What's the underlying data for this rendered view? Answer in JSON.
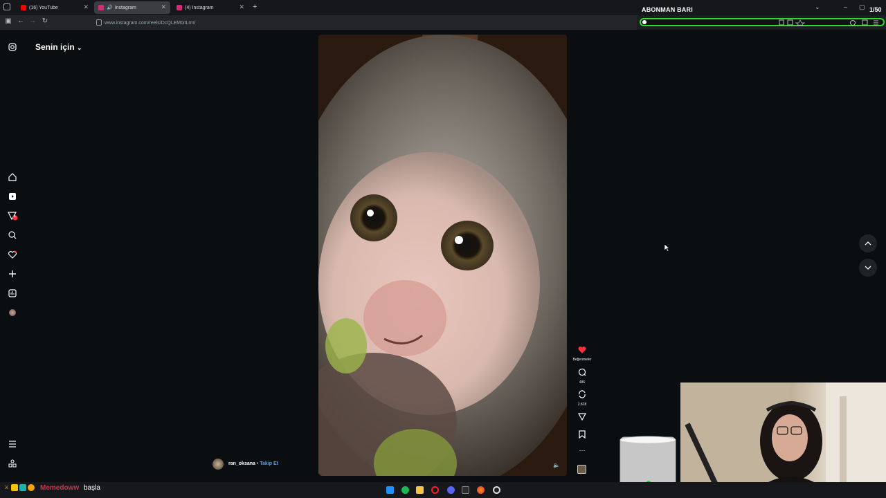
{
  "browser": {
    "tabs": [
      {
        "label": "(16) YouTube",
        "color": "#ff0000"
      },
      {
        "label": "Instagram",
        "color": "#d62976",
        "active": true
      },
      {
        "label": "(4) Instagram",
        "color": "#d62976"
      }
    ],
    "url": "www.instagram.com/reels/DcQLEMGtLrm/"
  },
  "overlay": {
    "abonman_title": "ABONMAN BARI",
    "abonman_count": "1/50",
    "progress": 0.02,
    "accent": "#2bdc2b"
  },
  "instagram": {
    "page_title": "Senin için",
    "notification_count": "4",
    "reel": {
      "username": "ran_oksana",
      "follow_label": "Takip Et",
      "likes_label": "Beğenmeler",
      "comments_count": "486",
      "reposts_count": "2.828",
      "more_label": "···"
    }
  },
  "stream": {
    "chat_user": "Memedoww",
    "chat_message": "başla"
  }
}
